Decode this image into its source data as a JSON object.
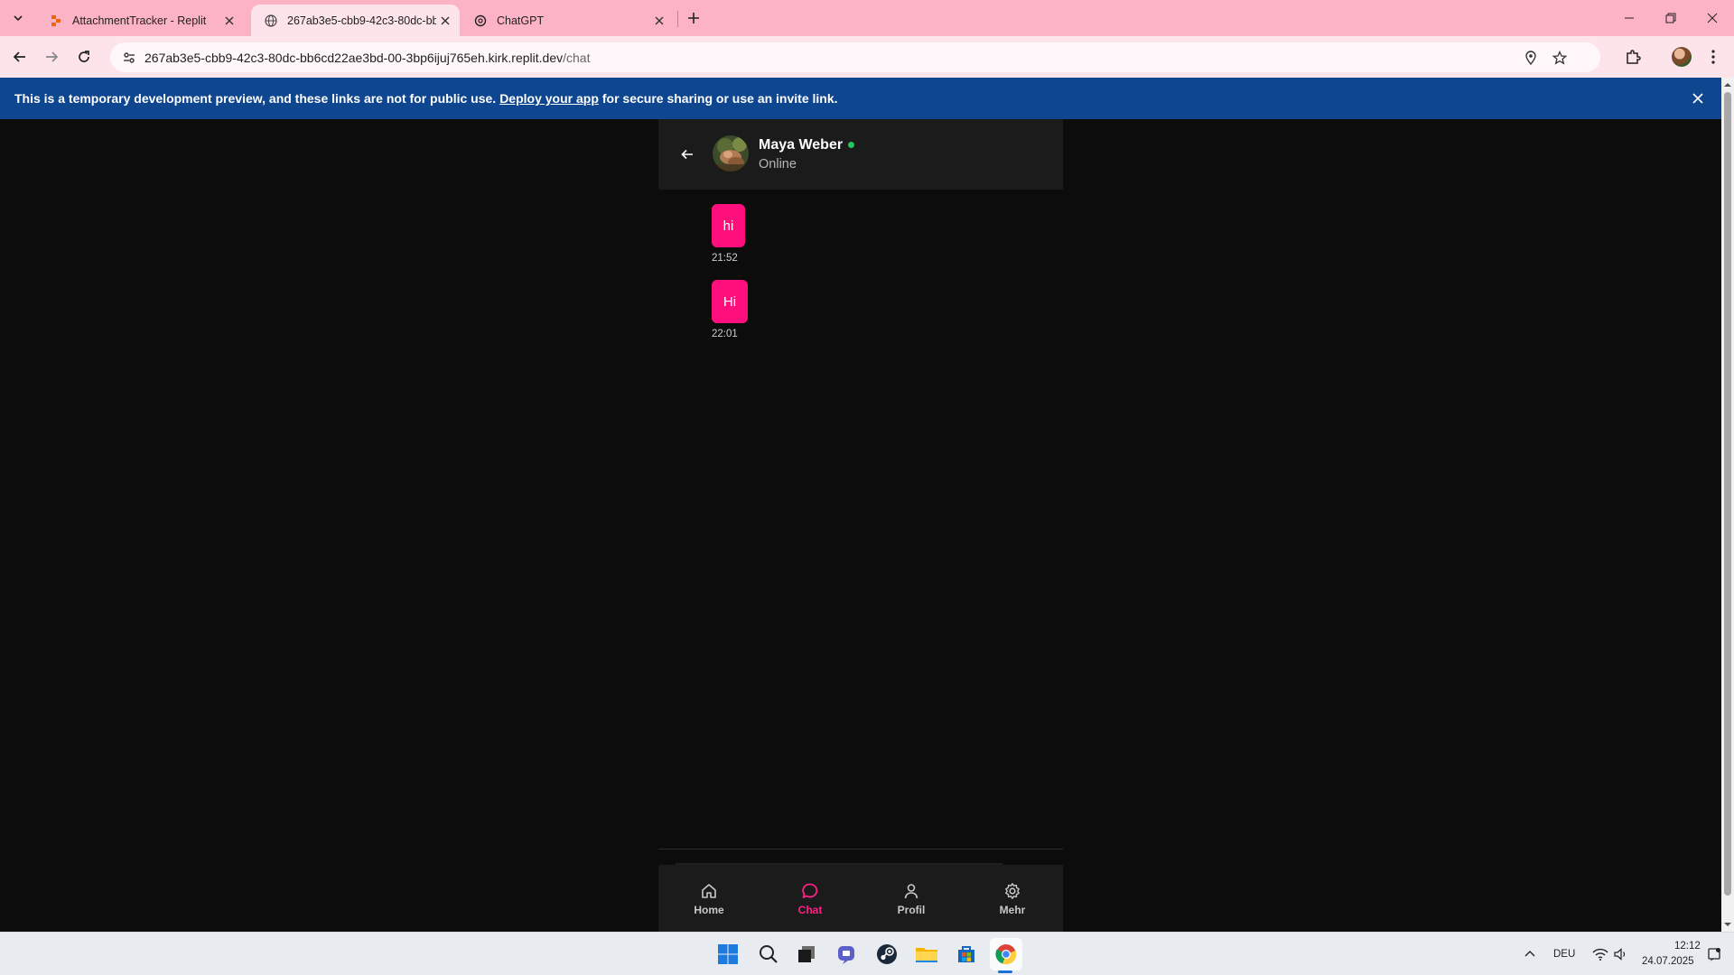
{
  "browser": {
    "tabs": [
      {
        "title": "AttachmentTracker - Replit",
        "active": false
      },
      {
        "title": "267ab3e5-cbb9-42c3-80dc-bb6",
        "active": true
      },
      {
        "title": "ChatGPT",
        "active": false
      }
    ],
    "url_host": "267ab3e5-cbb9-42c3-80dc-bb6cd22ae3bd-00-3bp6ijuj765eh.kirk.replit.dev",
    "url_path": "/chat"
  },
  "banner": {
    "text_before": "This is a temporary development preview, and these links are not for public use.",
    "link": "Deploy your app",
    "text_after": "for secure sharing or use an invite link."
  },
  "chat": {
    "contact_name": "Maya Weber",
    "status": "Online",
    "messages": [
      {
        "text": "hi",
        "time": "21:52"
      },
      {
        "text": "Hi",
        "time": "22:01"
      }
    ]
  },
  "nav": {
    "items": [
      {
        "label": "Home",
        "icon": "home-icon",
        "active": false
      },
      {
        "label": "Chat",
        "icon": "chat-icon",
        "active": true
      },
      {
        "label": "Profil",
        "icon": "user-icon",
        "active": false
      },
      {
        "label": "Mehr",
        "icon": "gear-icon",
        "active": false
      }
    ]
  },
  "taskbar": {
    "language": "DEU",
    "time": "12:12",
    "date": "24.07.2025"
  },
  "colors": {
    "accent": "#ff0f7b",
    "online": "#22c55e",
    "banner": "#0f4690",
    "tabstrip": "#fdb3c6"
  }
}
